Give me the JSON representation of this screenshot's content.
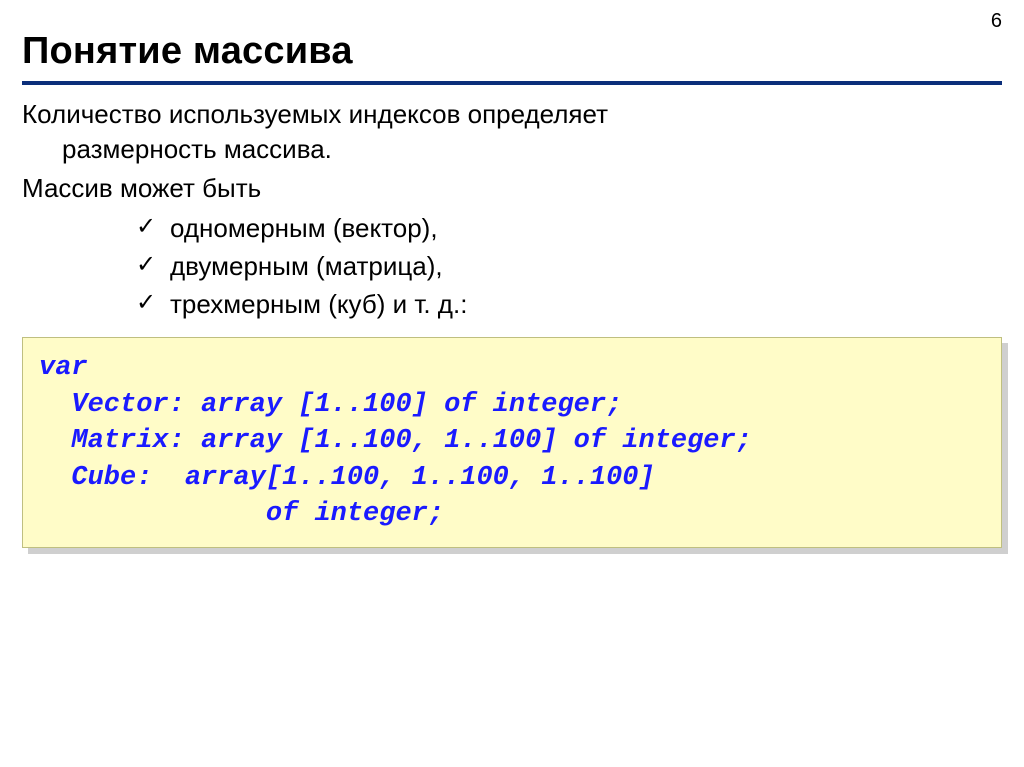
{
  "page_number": "6",
  "title": "Понятие массива",
  "paragraph1_line1": "Количество используемых индексов определяет",
  "paragraph1_line2": "размерность массива.",
  "paragraph2": "Массив может быть",
  "bullets": [
    "одномерным (вектор),",
    "двумерным (матрица),",
    "трехмерным (куб) и т. д.:"
  ],
  "code_lines": [
    "var",
    "  Vector: array [1..100] of integer;",
    "  Matrix: array [1..100, 1..100] of integer;",
    "  Cube:  array[1..100, 1..100, 1..100]",
    "              of integer;"
  ]
}
